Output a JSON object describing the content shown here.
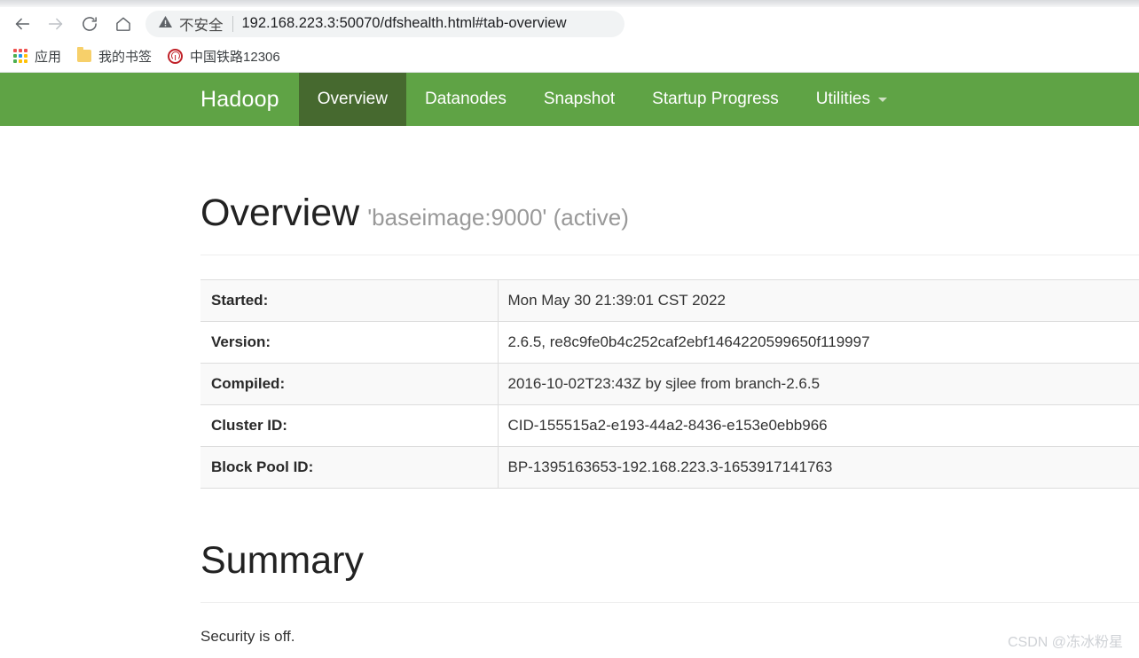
{
  "browser": {
    "nav": {
      "back_label": "Back",
      "forward_label": "Forward",
      "reload_label": "Reload",
      "home_label": "Home"
    },
    "omnibox": {
      "security_label": "不安全",
      "security_icon": "warning-triangle-icon",
      "url": "192.168.223.3:50070/dfshealth.html#tab-overview"
    },
    "bookmarks": [
      {
        "icon": "apps-grid-icon",
        "label": "应用"
      },
      {
        "icon": "folder-icon",
        "label": "我的书签"
      },
      {
        "icon": "railway-12306-icon",
        "label": "中国铁路12306"
      }
    ]
  },
  "navbar": {
    "brand": "Hadoop",
    "brand_color": "#ffffff",
    "background_color": "#5fa345",
    "active_background_color": "#46692f",
    "items": [
      {
        "label": "Overview",
        "active": true
      },
      {
        "label": "Datanodes",
        "active": false
      },
      {
        "label": "Snapshot",
        "active": false
      },
      {
        "label": "Startup Progress",
        "active": false
      },
      {
        "label": "Utilities",
        "active": false,
        "has_caret": true
      }
    ]
  },
  "page": {
    "heading": "Overview",
    "heading_sub": "'baseimage:9000' (active)",
    "table": {
      "rows": [
        {
          "key": "Started:",
          "value": "Mon May 30 21:39:01 CST 2022"
        },
        {
          "key": "Version:",
          "value": "2.6.5, re8c9fe0b4c252caf2ebf1464220599650f119997"
        },
        {
          "key": "Compiled:",
          "value": "2016-10-02T23:43Z by sjlee from branch-2.6.5"
        },
        {
          "key": "Cluster ID:",
          "value": "CID-155515a2-e193-44a2-8436-e153e0ebb966"
        },
        {
          "key": "Block Pool ID:",
          "value": "BP-1395163653-192.168.223.3-1653917141763"
        }
      ]
    },
    "summary_heading": "Summary",
    "security_status": "Security is off."
  },
  "watermark": "CSDN @冻冰粉星"
}
